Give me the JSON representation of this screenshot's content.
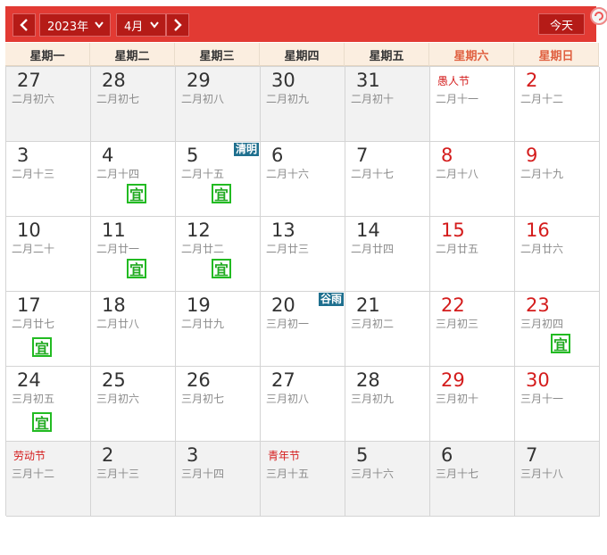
{
  "header": {
    "year": "2023年",
    "month": "4月",
    "today_label": "今天"
  },
  "weekdays": [
    {
      "label": "星期一",
      "weekend": false
    },
    {
      "label": "星期二",
      "weekend": false
    },
    {
      "label": "星期三",
      "weekend": false
    },
    {
      "label": "星期四",
      "weekend": false
    },
    {
      "label": "星期五",
      "weekend": false
    },
    {
      "label": "星期六",
      "weekend": true
    },
    {
      "label": "星期日",
      "weekend": true
    }
  ],
  "colors": {
    "header_red": "#e23a33",
    "button_red": "#b51b17",
    "holiday_red": "#d41c1c",
    "term_blue": "#1e6f8e",
    "yi_green": "#22aa22"
  },
  "days": [
    {
      "day": "27",
      "lunar": "二月初六",
      "other": true
    },
    {
      "day": "28",
      "lunar": "二月初七",
      "other": true
    },
    {
      "day": "29",
      "lunar": "二月初八",
      "other": true
    },
    {
      "day": "30",
      "lunar": "二月初九",
      "other": true
    },
    {
      "day": "31",
      "lunar": "二月初十",
      "other": true
    },
    {
      "day": "1",
      "festival": "愚人节",
      "lunar": "二月十一",
      "red": true
    },
    {
      "day": "2",
      "lunar": "二月十二",
      "red": true
    },
    {
      "day": "3",
      "lunar": "二月十三"
    },
    {
      "day": "4",
      "lunar": "二月十四",
      "yi": "宜"
    },
    {
      "day": "5",
      "lunar": "二月十五",
      "term": "清明",
      "yi": "宜"
    },
    {
      "day": "6",
      "lunar": "二月十六"
    },
    {
      "day": "7",
      "lunar": "二月十七"
    },
    {
      "day": "8",
      "lunar": "二月十八",
      "red": true
    },
    {
      "day": "9",
      "lunar": "二月十九",
      "red": true
    },
    {
      "day": "10",
      "lunar": "二月二十"
    },
    {
      "day": "11",
      "lunar": "二月廿一",
      "yi": "宜"
    },
    {
      "day": "12",
      "lunar": "二月廿二",
      "yi": "宜"
    },
    {
      "day": "13",
      "lunar": "二月廿三"
    },
    {
      "day": "14",
      "lunar": "二月廿四"
    },
    {
      "day": "15",
      "lunar": "二月廿五",
      "red": true
    },
    {
      "day": "16",
      "lunar": "二月廿六",
      "red": true
    },
    {
      "day": "17",
      "lunar": "二月廿七",
      "yi": "宜",
      "yi_left": true
    },
    {
      "day": "18",
      "lunar": "二月廿八"
    },
    {
      "day": "19",
      "lunar": "二月廿九"
    },
    {
      "day": "20",
      "lunar": "三月初一",
      "term": "谷雨"
    },
    {
      "day": "21",
      "lunar": "三月初二"
    },
    {
      "day": "22",
      "lunar": "三月初三",
      "red": true
    },
    {
      "day": "23",
      "lunar": "三月初四",
      "red": true,
      "yi": "宜"
    },
    {
      "day": "24",
      "lunar": "三月初五",
      "yi": "宜",
      "yi_left": true
    },
    {
      "day": "25",
      "lunar": "三月初六"
    },
    {
      "day": "26",
      "lunar": "三月初七"
    },
    {
      "day": "27",
      "lunar": "三月初八"
    },
    {
      "day": "28",
      "lunar": "三月初九"
    },
    {
      "day": "29",
      "lunar": "三月初十",
      "red": true
    },
    {
      "day": "30",
      "lunar": "三月十一",
      "red": true
    },
    {
      "day": "1",
      "festival": "劳动节",
      "lunar": "三月十二",
      "other": true
    },
    {
      "day": "2",
      "lunar": "三月十三",
      "other": true
    },
    {
      "day": "3",
      "lunar": "三月十四",
      "other": true
    },
    {
      "day": "4",
      "festival": "青年节",
      "lunar": "三月十五",
      "other": true
    },
    {
      "day": "5",
      "lunar": "三月十六",
      "other": true
    },
    {
      "day": "6",
      "lunar": "三月十七",
      "other": true
    },
    {
      "day": "7",
      "lunar": "三月十八",
      "other": true
    }
  ]
}
